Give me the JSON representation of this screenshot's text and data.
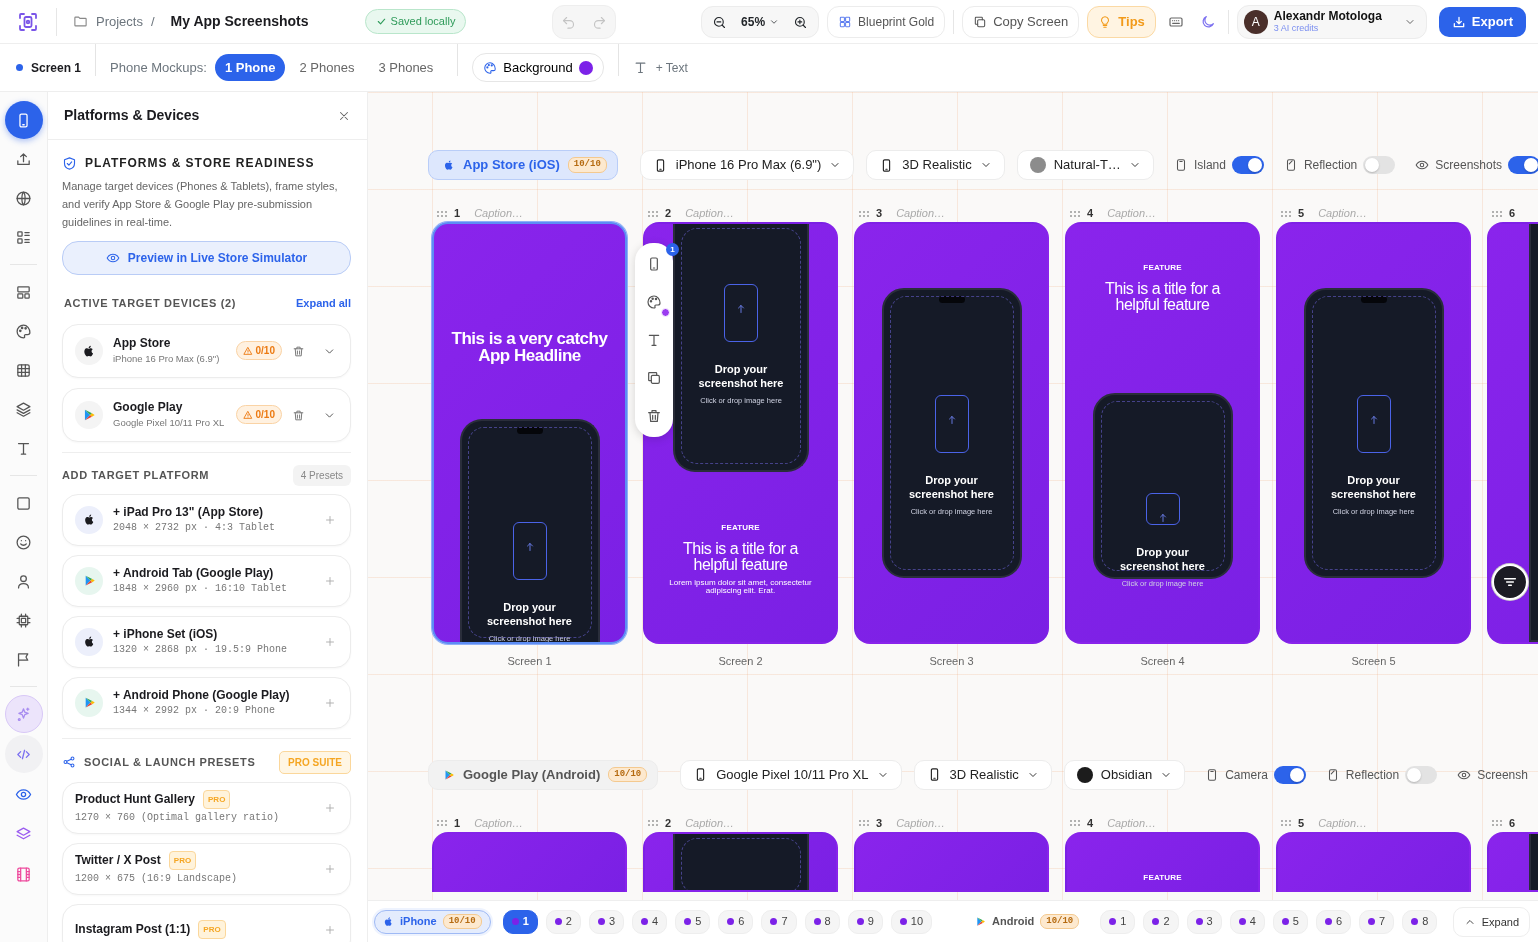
{
  "topbar": {
    "parent": "Projects",
    "separator": "/",
    "current": "My App Screenshots",
    "saved": "Saved locally",
    "zoom": "65%",
    "template": "Blueprint Gold",
    "copy": "Copy Screen",
    "tips": "Tips",
    "user": {
      "initial": "A",
      "name": "Alexandr Motologa",
      "credits": "3 AI credits"
    },
    "export": "Export"
  },
  "screen_bar": {
    "screen": "Screen 1",
    "mockups_label": "Phone Mockups:",
    "mockups": [
      {
        "label": "1 Phone",
        "selected": true
      },
      {
        "label": "2 Phones",
        "selected": false
      },
      {
        "label": "3 Phones",
        "selected": false
      }
    ],
    "background": {
      "label": "Background",
      "color": "#7c22e8"
    },
    "add_text": "+ Text"
  },
  "rail": {
    "groups": [
      {
        "items": [
          {
            "kind": "phone",
            "selected": true
          },
          {
            "kind": "upload",
            "selected": false
          },
          {
            "kind": "globe",
            "selected": false
          },
          {
            "kind": "list",
            "selected": false
          }
        ]
      },
      {
        "items": [
          {
            "kind": "layout",
            "selected": false
          },
          {
            "kind": "palette",
            "selected": false
          },
          {
            "kind": "grid",
            "selected": false
          },
          {
            "kind": "layers",
            "selected": false
          },
          {
            "kind": "text",
            "selected": false
          }
        ]
      },
      {
        "items": [
          {
            "kind": "square",
            "selected": false
          },
          {
            "kind": "smiley",
            "selected": false
          },
          {
            "kind": "user",
            "selected": false
          },
          {
            "kind": "chip",
            "selected": false
          },
          {
            "kind": "flag",
            "selected": false
          }
        ]
      },
      {
        "items": [
          {
            "kind": "sparkle",
            "selected": false
          },
          {
            "kind": "code",
            "selected": false
          },
          {
            "kind": "eye",
            "selected": false
          },
          {
            "kind": "stack",
            "selected": false
          },
          {
            "kind": "film",
            "selected": false
          }
        ]
      }
    ]
  },
  "panel": {
    "title": "Platforms & Devices",
    "readiness": {
      "heading": "PLATFORMS & STORE READINESS",
      "description": "Manage target devices (Phones & Tablets), frame styles, and verify App Store & Google Play pre-submission guidelines in real-time.",
      "preview": "Preview in Live Store Simulator"
    },
    "active": {
      "heading": "ACTIVE TARGET DEVICES (2)",
      "action": "Expand all",
      "devices": [
        {
          "kind": "apple",
          "name": "App Store",
          "device": "iPhone 16 Pro Max (6.9\")",
          "score": "0/10"
        },
        {
          "kind": "play",
          "name": "Google Play",
          "device": "Google Pixel 10/11 Pro XL",
          "score": "0/10"
        }
      ]
    },
    "add": {
      "heading": "ADD TARGET PLATFORM",
      "count": "4 Presets",
      "platforms": [
        {
          "kind": "apple",
          "name": "+ iPad Pro 13\" (App Store)",
          "spec": "2048 × 2732 px · 4:3 Tablet"
        },
        {
          "kind": "play",
          "name": "+ Android Tab (Google Play)",
          "spec": "1848 × 2960 px · 16:10 Tablet"
        },
        {
          "kind": "apple",
          "name": "+ iPhone Set (iOS)",
          "spec": "1320 × 2868 px · 19.5:9 Phone"
        },
        {
          "kind": "play",
          "name": "+ Android Phone (Google Play)",
          "spec": "1344 × 2992 px · 20:9 Phone"
        }
      ]
    },
    "social": {
      "heading": "SOCIAL & LAUNCH PRESETS",
      "badge": "PRO SUITE",
      "presets": [
        {
          "name": "Product Hunt Gallery",
          "badge": "PRO",
          "spec": "1270 × 760 (Optimal gallery ratio)"
        },
        {
          "name": "Twitter / X Post",
          "badge": "PRO",
          "spec": "1200 × 675 (16:9 Landscape)"
        },
        {
          "name": "Instagram Post (1:1)",
          "badge": "PRO"
        }
      ]
    }
  },
  "canvas": {
    "tools": [
      {
        "kind": "phone",
        "badge": "1"
      },
      {
        "kind": "palette"
      },
      {
        "kind": "text"
      },
      {
        "kind": "copy"
      },
      {
        "kind": "trash"
      }
    ],
    "rows": [
      {
        "store": {
          "kind": "apple",
          "label": "App Store (iOS)",
          "score": "10/10",
          "selected": true
        },
        "device": "iPhone 16 Pro Max (6.9\")",
        "frame_style": "3D Realistic",
        "color": {
          "label": "Natural-T…",
          "color": "#8c8c8c"
        },
        "toggles": [
          {
            "kind": "island",
            "label": "Island",
            "on": true
          },
          {
            "kind": "reflection",
            "label": "Reflection",
            "on": false
          },
          {
            "kind": "eye",
            "label": "Screenshots",
            "on": true
          }
        ],
        "screens": [
          {
            "number": "1",
            "caption": "Caption…",
            "kind": "headline_phone",
            "selected": true,
            "headline": "This is a very catchy App Headline",
            "drop_title": "Drop your screenshot here",
            "drop_hint": "Click or drop image here",
            "label": "Screen 1"
          },
          {
            "number": "2",
            "caption": "Caption…",
            "kind": "phone_feature",
            "selected": false,
            "drop_title": "Drop your screenshot here",
            "drop_hint": "Click or drop image here",
            "eyebrow": "FEATURE",
            "title": "This is a title for a helpful feature",
            "body": "Lorem ipsum dolor sit amet, consectetur adipiscing elit. Erat.",
            "label": "Screen 2"
          },
          {
            "number": "3",
            "caption": "Caption…",
            "kind": "phone",
            "selected": false,
            "drop_title": "Drop your screenshot here",
            "drop_hint": "Click or drop image here",
            "label": "Screen 3"
          },
          {
            "number": "4",
            "caption": "Caption…",
            "kind": "feature_phone",
            "selected": false,
            "eyebrow": "FEATURE",
            "title": "This is a title for a helpful feature",
            "drop_title": "Drop your screenshot here",
            "drop_hint": "Click or drop image here",
            "label": "Screen 4"
          },
          {
            "number": "5",
            "caption": "Caption…",
            "kind": "phone",
            "selected": false,
            "drop_title": "Drop your screenshot here",
            "drop_hint": "Click or drop image here",
            "label": "Screen 5"
          },
          {
            "number": "6",
            "kind": "edge",
            "selected": false
          }
        ]
      },
      {
        "store": {
          "kind": "play",
          "label": "Google Play (Android)",
          "score": "10/10",
          "selected": false
        },
        "device": "Google Pixel 10/11 Pro XL",
        "frame_style": "3D Realistic",
        "color": {
          "label": "Obsidian",
          "color": "#1c1c1c"
        },
        "toggles": [
          {
            "kind": "island",
            "label": "Camera",
            "on": true
          },
          {
            "kind": "reflection",
            "label": "Reflection",
            "on": false
          },
          {
            "kind": "eye",
            "label": "Screensh"
          }
        ],
        "screens": [
          {
            "number": "1",
            "caption": "Caption…",
            "kind": "top",
            "selected": false
          },
          {
            "number": "2",
            "caption": "Caption…",
            "kind": "phone_top",
            "selected": false
          },
          {
            "number": "3",
            "caption": "Caption…",
            "kind": "top",
            "selected": false
          },
          {
            "number": "4",
            "caption": "Caption…",
            "kind": "feature_top",
            "selected": false,
            "eyebrow": "FEATURE"
          },
          {
            "number": "5",
            "caption": "Caption…",
            "kind": "top",
            "selected": false
          },
          {
            "number": "6",
            "kind": "edge",
            "selected": false
          }
        ]
      }
    ]
  },
  "bottom_bar": {
    "groups": [
      {
        "kind": "apple",
        "label": "iPhone",
        "score": "10/10",
        "selected": true,
        "screens": [
          {
            "label": "1",
            "selected": true
          },
          {
            "label": "2",
            "selected": false
          },
          {
            "label": "3",
            "selected": false
          },
          {
            "label": "4",
            "selected": false
          },
          {
            "label": "5",
            "selected": false
          },
          {
            "label": "6",
            "selected": false
          },
          {
            "label": "7",
            "selected": false
          },
          {
            "label": "8",
            "selected": false
          },
          {
            "label": "9",
            "selected": false
          },
          {
            "label": "10",
            "selected": false
          }
        ]
      },
      {
        "kind": "play",
        "label": "Android",
        "score": "10/10",
        "selected": false,
        "screens": [
          {
            "label": "1",
            "selected": false
          },
          {
            "label": "2",
            "selected": false
          },
          {
            "label": "3",
            "selected": false
          },
          {
            "label": "4",
            "selected": false
          },
          {
            "label": "5",
            "selected": false
          },
          {
            "label": "6",
            "selected": false
          },
          {
            "label": "7",
            "selected": false
          },
          {
            "label": "8",
            "selected": false
          }
        ]
      }
    ],
    "expand": "Expand"
  }
}
